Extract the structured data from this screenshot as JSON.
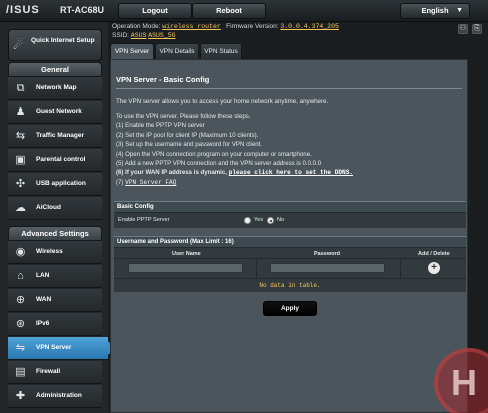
{
  "header": {
    "brand": "/ISUS",
    "model": "RT-AC68U",
    "logout": "Logout",
    "reboot": "Reboot",
    "language": "English",
    "op_mode_label": "Operation Mode:",
    "op_mode_value": "wireless router",
    "firmware_label": "Firmware Version:",
    "firmware_value": "3.0.0.4.374_205",
    "ssid_label": "SSID:",
    "ssid_1": "ASUS",
    "ssid_2": "ASUS_5G"
  },
  "sidebar": {
    "qis_label": "Quick Internet Setup",
    "general_title": "General",
    "general_items": [
      {
        "label": "Network Map",
        "icon": "network-map-icon"
      },
      {
        "label": "Guest Network",
        "icon": "guest-network-icon"
      },
      {
        "label": "Traffic Manager",
        "icon": "traffic-manager-icon"
      },
      {
        "label": "Parental control",
        "icon": "parental-control-icon"
      },
      {
        "label": "USB application",
        "icon": "usb-application-icon"
      },
      {
        "label": "AiCloud",
        "icon": "aicloud-icon"
      }
    ],
    "advanced_title": "Advanced Settings",
    "advanced_items": [
      {
        "label": "Wireless",
        "icon": "wireless-icon"
      },
      {
        "label": "LAN",
        "icon": "lan-icon"
      },
      {
        "label": "WAN",
        "icon": "wan-icon"
      },
      {
        "label": "IPv6",
        "icon": "ipv6-icon"
      },
      {
        "label": "VPN Server",
        "icon": "vpn-server-icon",
        "active": true
      },
      {
        "label": "Firewall",
        "icon": "firewall-icon"
      },
      {
        "label": "Administration",
        "icon": "administration-icon"
      }
    ]
  },
  "tabs": [
    "VPN Server",
    "VPN Details",
    "VPN Status"
  ],
  "main": {
    "title": "VPN Server - Basic Config",
    "intro": "The VPN server allows you to access your home network anytime, anywhere.",
    "steps_intro": "To use the VPN server. Please follow these steps.",
    "steps": [
      "(1) Enable the PPTP VPN server",
      "(2) Set the IP pool for client IP (Maximum 10 clients).",
      "(3) Set up the username and password for VPN client.",
      "(4) Open the VPN connection program on your computer or smartphone.",
      "(5) Add a new PPTP VPN connection and the VPN server address is 0.0.0.0"
    ],
    "step6_text": "(6) If your WAN IP address is dynamic,",
    "step6_link": "please click here to set the DDNS.",
    "step7_prefix": "(7)",
    "step7_link": "VPN Server FAQ",
    "basic_config_title": "Basic Config",
    "enable_label": "Enable PPTP Server",
    "yes": "Yes",
    "no": "No",
    "enable_selected": "No",
    "userpass_title": "Username and Password (Max Limit : 16)",
    "col_user": "User Name",
    "col_pass": "Password",
    "col_add": "Add / Delete",
    "no_data": "No data in table.",
    "apply": "Apply"
  },
  "watermark": "H"
}
